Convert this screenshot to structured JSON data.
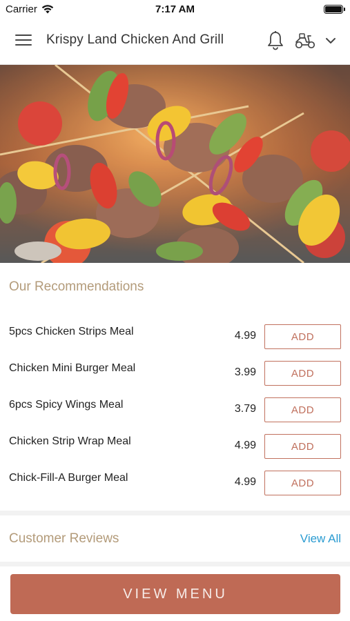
{
  "status_bar": {
    "carrier": "Carrier",
    "time": "7:17 AM"
  },
  "header": {
    "title": "Krispy Land Chicken And Grill",
    "icons": [
      "menu-icon",
      "bell-icon",
      "scooter-icon",
      "chevron-down-icon"
    ]
  },
  "recommendations": {
    "title": "Our Recommendations",
    "items": [
      {
        "name": "5pcs Chicken Strips Meal",
        "price": "4.99",
        "button": "ADD"
      },
      {
        "name": "Chicken Mini Burger Meal",
        "price": "3.99",
        "button": "ADD"
      },
      {
        "name": "6pcs Spicy Wings Meal",
        "price": "3.79",
        "button": "ADD"
      },
      {
        "name": "Chicken Strip Wrap Meal",
        "price": "4.99",
        "button": "ADD"
      },
      {
        "name": "Chick-Fill-A Burger Meal",
        "price": "4.99",
        "button": "ADD"
      }
    ]
  },
  "reviews": {
    "title": "Customer Reviews",
    "view_all": "View All"
  },
  "footer": {
    "view_menu": "VIEW MENU"
  },
  "colors": {
    "accent": "#bf6a55",
    "section_title": "#b39b7a",
    "link": "#2a9bd1"
  }
}
